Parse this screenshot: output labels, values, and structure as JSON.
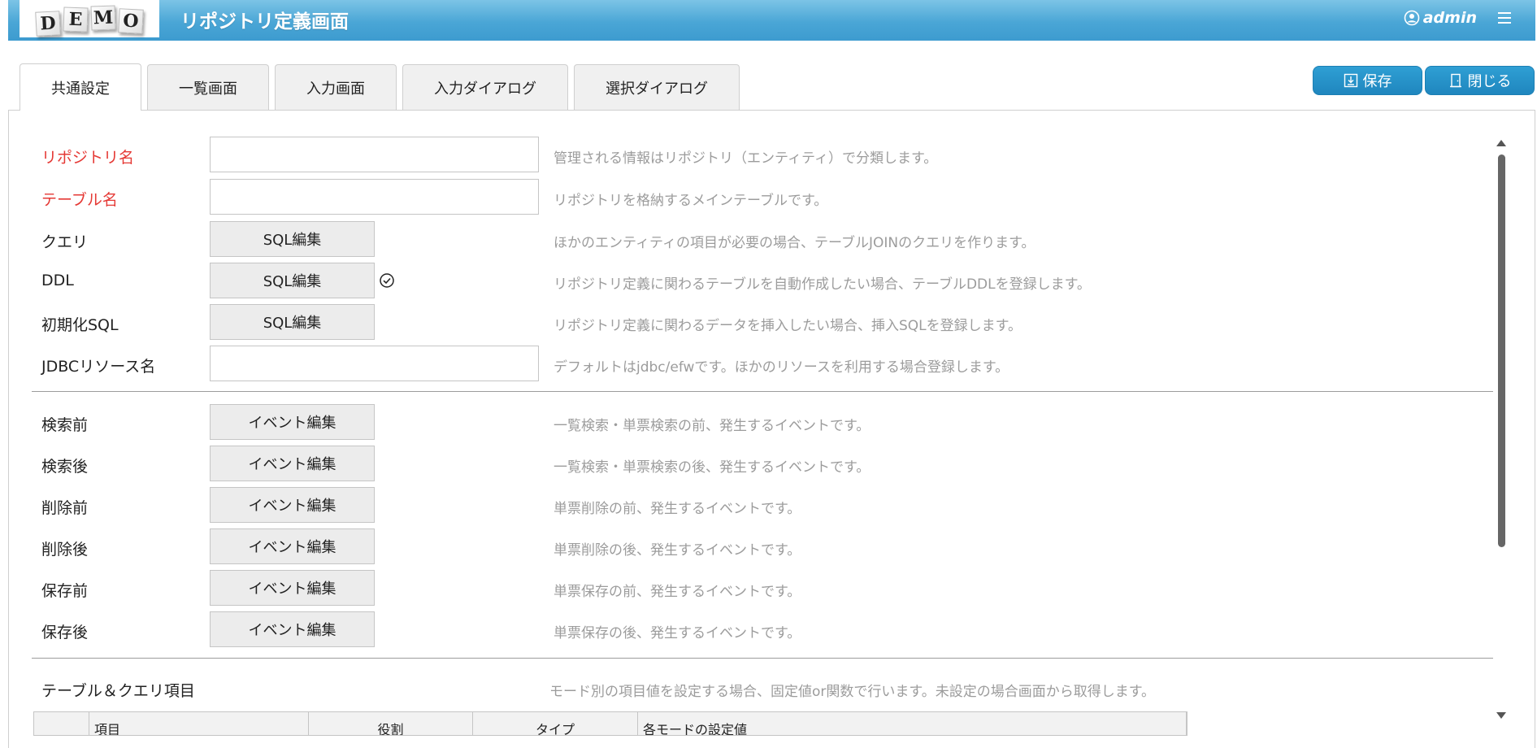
{
  "header": {
    "logo_letters": [
      "D",
      "E",
      "M",
      "O"
    ],
    "title": "リポジトリ定義画面",
    "user": "admin"
  },
  "tabs": [
    {
      "label": "共通設定",
      "active": true
    },
    {
      "label": "一覧画面",
      "active": false
    },
    {
      "label": "入力画面",
      "active": false
    },
    {
      "label": "入力ダイアログ",
      "active": false
    },
    {
      "label": "選択ダイアログ",
      "active": false
    }
  ],
  "actions": {
    "save": "保存",
    "close": "閉じる"
  },
  "form": {
    "repository_name": {
      "label": "リポジトリ名",
      "value": "",
      "hint": "管理される情報はリポジトリ（エンティティ）で分類します。"
    },
    "table_name": {
      "label": "テーブル名",
      "value": "",
      "hint": "リポジトリを格納するメインテーブルです。"
    },
    "query": {
      "label": "クエリ",
      "button": "SQL編集",
      "hint": "ほかのエンティティの項目が必要の場合、テーブルJOINのクエリを作ります。"
    },
    "ddl": {
      "label": "DDL",
      "button": "SQL編集",
      "hint": "リポジトリ定義に関わるテーブルを自動作成したい場合、テーブルDDLを登録します。"
    },
    "init_sql": {
      "label": "初期化SQL",
      "button": "SQL編集",
      "hint": "リポジトリ定義に関わるデータを挿入したい場合、挿入SQLを登録します。"
    },
    "jdbc": {
      "label": "JDBCリソース名",
      "value": "",
      "hint": "デフォルトはjdbc/efwです。ほかのリソースを利用する場合登録します。"
    }
  },
  "events": [
    {
      "label": "検索前",
      "button": "イベント編集",
      "hint": "一覧検索・単票検索の前、発生するイベントです。"
    },
    {
      "label": "検索後",
      "button": "イベント編集",
      "hint": "一覧検索・単票検索の後、発生するイベントです。"
    },
    {
      "label": "削除前",
      "button": "イベント編集",
      "hint": "単票削除の前、発生するイベントです。"
    },
    {
      "label": "削除後",
      "button": "イベント編集",
      "hint": "単票削除の後、発生するイベントです。"
    },
    {
      "label": "保存前",
      "button": "イベント編集",
      "hint": "単票保存の前、発生するイベントです。"
    },
    {
      "label": "保存後",
      "button": "イベント編集",
      "hint": "単票保存の後、発生するイベントです。"
    }
  ],
  "items_section": {
    "label": "テーブル＆クエリ項目",
    "hint": "モード別の項目値を設定する場合、固定値or関数で行います。未設定の場合画面から取得します。",
    "columns": [
      "",
      "項目",
      "役割",
      "タイプ",
      "各モードの設定値"
    ]
  },
  "colors": {
    "required": "#e53935",
    "accent": "#1f86be",
    "hint": "#9c9c9c"
  }
}
